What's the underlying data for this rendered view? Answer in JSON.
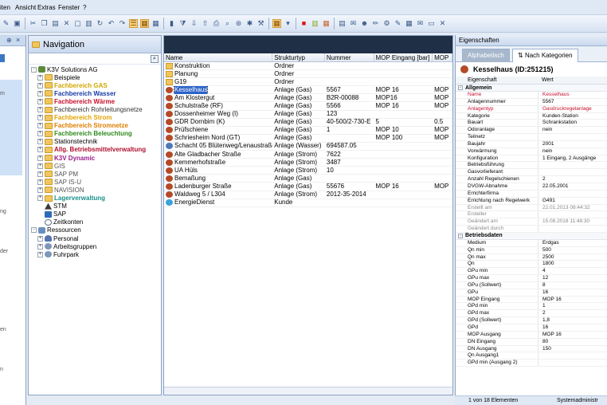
{
  "menu": {
    "items": [
      "iten",
      "Ansicht",
      "Extras",
      "Fenster",
      "?"
    ]
  },
  "left_strip": {
    "text": [
      "m",
      "ng",
      "der",
      "en",
      "n"
    ]
  },
  "nav": {
    "title": "Navigation",
    "tree": [
      {
        "label": "K3V Solutions AG",
        "icon": "root-icon",
        "expander": "-",
        "indent": 0,
        "style": ""
      },
      {
        "label": "Beispiele",
        "icon": "folder-icon",
        "expander": "+",
        "indent": 1,
        "style": ""
      },
      {
        "label": "Fachbereich GAS",
        "icon": "folder-icon",
        "expander": "+",
        "indent": 1,
        "style": "b c-gas"
      },
      {
        "label": "Fachbereich Wasser",
        "icon": "folder-icon",
        "expander": "+",
        "indent": 1,
        "style": "b c-wasser"
      },
      {
        "label": "Fachbereich Wärme",
        "icon": "folder-icon",
        "expander": "+",
        "indent": 1,
        "style": "b c-waerme"
      },
      {
        "label": "Fachbereich Rohrleitungsnetze",
        "icon": "folder-icon",
        "expander": "+",
        "indent": 1,
        "style": "c-rohr"
      },
      {
        "label": "Fachbereich Strom",
        "icon": "folder-icon",
        "expander": "+",
        "indent": 1,
        "style": "b c-strom"
      },
      {
        "label": "Fachbereich Stromnetze",
        "icon": "folder-icon",
        "expander": "+",
        "indent": 1,
        "style": "b c-stromnetze"
      },
      {
        "label": "Fachbereich Beleuchtung",
        "icon": "folder-icon",
        "expander": "+",
        "indent": 1,
        "style": "b c-bel"
      },
      {
        "label": "Stationstechnik",
        "icon": "folder-icon",
        "expander": "+",
        "indent": 1,
        "style": ""
      },
      {
        "label": "Allg. Betriebsmittelverwaltung",
        "icon": "folder-icon",
        "expander": "+",
        "indent": 1,
        "style": "b c-allg"
      },
      {
        "label": "K3V Dynamic",
        "icon": "folder-icon",
        "expander": "+",
        "indent": 1,
        "style": "b c-dyn"
      },
      {
        "label": "GIS",
        "icon": "folder-icon",
        "expander": "+",
        "indent": 1,
        "style": "c-gray"
      },
      {
        "label": "SAP PM",
        "icon": "folder-icon",
        "expander": "+",
        "indent": 1,
        "style": "c-gray"
      },
      {
        "label": "SAP IS-U",
        "icon": "folder-icon",
        "expander": "+",
        "indent": 1,
        "style": "c-gray"
      },
      {
        "label": "NAVISION",
        "icon": "folder-icon",
        "expander": "+",
        "indent": 1,
        "style": "c-gray"
      },
      {
        "label": "Lagerverwaltung",
        "icon": "folder-icon",
        "expander": "+",
        "indent": 1,
        "style": "b c-lager"
      },
      {
        "label": "STM",
        "icon": "stm-icon",
        "expander": "",
        "indent": 1,
        "style": ""
      },
      {
        "label": "SAP",
        "icon": "sap-icon",
        "expander": "",
        "indent": 1,
        "style": ""
      },
      {
        "label": "Zeitkonten",
        "icon": "clock-icon",
        "expander": "",
        "indent": 1,
        "style": ""
      },
      {
        "label": "Ressourcen",
        "icon": "db-icon",
        "expander": "-",
        "indent": 0,
        "style": ""
      },
      {
        "label": "Personal",
        "icon": "group-icon",
        "expander": "+",
        "indent": 1,
        "style": ""
      },
      {
        "label": "Arbeitsgruppen",
        "icon": "gear-icon",
        "expander": "+",
        "indent": 1,
        "style": ""
      },
      {
        "label": "Fuhrpark",
        "icon": "gear-icon",
        "expander": "+",
        "indent": 1,
        "style": ""
      }
    ]
  },
  "grid": {
    "columns": [
      "Name",
      "Strukturtyp",
      "Nummer",
      "MOP Eingang [bar]",
      "MOP"
    ],
    "rows": [
      {
        "icon": "folder-icon",
        "name": "Konstruktion",
        "typ": "Ordner",
        "nummer": "",
        "mop_in": "",
        "mop": "",
        "selected": false
      },
      {
        "icon": "folder-icon",
        "name": "Planung",
        "typ": "Ordner",
        "nummer": "",
        "mop_in": "",
        "mop": "",
        "selected": false
      },
      {
        "icon": "folder-icon",
        "name": "G19",
        "typ": "Ordner",
        "nummer": "",
        "mop_in": "",
        "mop": "",
        "selected": false
      },
      {
        "icon": "asset-icon",
        "name": "Kesselhaus",
        "typ": "Anlage (Gas)",
        "nummer": "5567",
        "mop_in": "MOP 16",
        "mop": "MOP",
        "selected": true
      },
      {
        "icon": "asset-icon",
        "name": "Am Klostergut",
        "typ": "Anlage (Gas)",
        "nummer": "B2R-00088",
        "mop_in": "MOP16",
        "mop": "MOP",
        "selected": false
      },
      {
        "icon": "asset-icon",
        "name": "Schulstraße (RF)",
        "typ": "Anlage (Gas)",
        "nummer": "5566",
        "mop_in": "MOP 16",
        "mop": "MOP",
        "selected": false
      },
      {
        "icon": "asset-icon",
        "name": "Dossenheimer Weg (I)",
        "typ": "Anlage (Gas)",
        "nummer": "123",
        "mop_in": "",
        "mop": "",
        "selected": false
      },
      {
        "icon": "asset-icon",
        "name": "GDR Dornbim (K)",
        "typ": "Anlage (Gas)",
        "nummer": "40-500/2-730-E",
        "mop_in": "5",
        "mop": "0.5",
        "selected": false
      },
      {
        "icon": "asset-icon",
        "name": "Prüfschiene",
        "typ": "Anlage (Gas)",
        "nummer": "1",
        "mop_in": "MOP 10",
        "mop": "MOP",
        "selected": false
      },
      {
        "icon": "asset-icon",
        "name": "Schriesheim Nord (GT)",
        "typ": "Anlage (Gas)",
        "nummer": "",
        "mop_in": "MOP 100",
        "mop": "MOP",
        "selected": false
      },
      {
        "icon": "asset2-icon",
        "name": "Schacht 05 Blütenweg/Lenaustraße",
        "typ": "Anlage (Wasser)",
        "nummer": "694587.05",
        "mop_in": "",
        "mop": "",
        "selected": false
      },
      {
        "icon": "asset-icon",
        "name": "Alte Gladbacher Straße",
        "typ": "Anlage (Strom)",
        "nummer": "7622",
        "mop_in": "",
        "mop": "",
        "selected": false
      },
      {
        "icon": "asset-icon",
        "name": "Kemmerhofstraße",
        "typ": "Anlage (Strom)",
        "nummer": "3487",
        "mop_in": "",
        "mop": "",
        "selected": false
      },
      {
        "icon": "asset-icon",
        "name": "UA Hüls",
        "typ": "Anlage (Strom)",
        "nummer": "10",
        "mop_in": "",
        "mop": "",
        "selected": false
      },
      {
        "icon": "asset-icon",
        "name": "Bemaßung",
        "typ": "Anlage (Gas)",
        "nummer": "",
        "mop_in": "",
        "mop": "",
        "selected": false
      },
      {
        "icon": "asset-icon",
        "name": "Ladenburger Straße",
        "typ": "Anlage (Gas)",
        "nummer": "55676",
        "mop_in": "MOP 16",
        "mop": "MOP",
        "selected": false
      },
      {
        "icon": "asset-icon",
        "name": "Waldweg 5 / L304",
        "typ": "Anlage (Strom)",
        "nummer": "2012-35-2014",
        "mop_in": "",
        "mop": "",
        "selected": false
      },
      {
        "icon": "service-icon",
        "name": "EnergieDienst",
        "typ": "Kunde",
        "nummer": "",
        "mop_in": "",
        "mop": "",
        "selected": false
      }
    ]
  },
  "props": {
    "title": "Eigenschaften",
    "tabs": [
      "Alphabetisch",
      "Nach Kategorien"
    ],
    "object_name": "Kesselhaus (ID:251215)",
    "col_property": "Eigenschaft",
    "col_value": "Wert",
    "categories": [
      {
        "name": "Allgemein",
        "rows": [
          {
            "label": "Name",
            "value": "Kesselhaus",
            "style": "red"
          },
          {
            "label": "Anlagennummer",
            "value": "5567",
            "style": ""
          },
          {
            "label": "Anlagentyp",
            "value": "Gasdruckregelanlage",
            "style": "red"
          },
          {
            "label": "Kategorie",
            "value": "Kunden-Station",
            "style": ""
          },
          {
            "label": "Bauart",
            "value": "Schrankstation",
            "style": ""
          },
          {
            "label": "Odoranlage",
            "value": "nein",
            "style": ""
          },
          {
            "label": "Teilnetz",
            "value": "",
            "style": ""
          },
          {
            "label": "Baujahr",
            "value": "2001",
            "style": ""
          },
          {
            "label": "Vorwärmung",
            "value": "nein",
            "style": ""
          },
          {
            "label": "Konfiguration",
            "value": "1 Eingang, 2 Ausgänge",
            "style": ""
          },
          {
            "label": "Betriebsführung",
            "value": "",
            "style": ""
          },
          {
            "label": "Gasvorlieferant",
            "value": "",
            "style": ""
          },
          {
            "label": "Anzahl Regelschienen",
            "value": "2",
            "style": ""
          },
          {
            "label": "DVGW-Abnahme",
            "value": "22.05.2001",
            "style": ""
          },
          {
            "label": "Errichterfirma",
            "value": "",
            "style": ""
          },
          {
            "label": "Errichtung nach Regelwerk",
            "value": "G491",
            "style": ""
          },
          {
            "label": "Erstellt am",
            "value": "22.01.2013 08:44:32",
            "style": "gray"
          },
          {
            "label": "Ersteller",
            "value": "",
            "style": "gray"
          },
          {
            "label": "Geändert am",
            "value": "15.08.2018 11:48:30",
            "style": "gray"
          },
          {
            "label": "Geändert durch",
            "value": "",
            "style": "gray"
          }
        ]
      },
      {
        "name": "Betriebsdaten",
        "rows": [
          {
            "label": "Medium",
            "value": "Erdgas",
            "style": ""
          },
          {
            "label": "Qn min",
            "value": "500",
            "style": ""
          },
          {
            "label": "Qn max",
            "value": "2500",
            "style": ""
          },
          {
            "label": "Qn",
            "value": "1800",
            "style": ""
          },
          {
            "label": "GPu min",
            "value": "4",
            "style": ""
          },
          {
            "label": "GPu max",
            "value": "12",
            "style": ""
          },
          {
            "label": "GPu (Sollwert)",
            "value": "8",
            "style": ""
          },
          {
            "label": "GPu",
            "value": "16",
            "style": ""
          },
          {
            "label": "MOP Eingang",
            "value": "MOP 16",
            "style": ""
          },
          {
            "label": "GPd min",
            "value": "1",
            "style": ""
          },
          {
            "label": "GPd max",
            "value": "2",
            "style": ""
          },
          {
            "label": "GPd (Sollwert)",
            "value": "1,8",
            "style": ""
          },
          {
            "label": "GPd",
            "value": "16",
            "style": ""
          },
          {
            "label": "MOP Ausgang",
            "value": "MOP 16",
            "style": ""
          },
          {
            "label": "DN Eingang",
            "value": "80",
            "style": ""
          },
          {
            "label": "DN Ausgang",
            "value": "150",
            "style": ""
          },
          {
            "label": "Qn Ausgang1",
            "value": "",
            "style": ""
          },
          {
            "label": "GPd min (Ausgang 2)",
            "value": "",
            "style": ""
          }
        ]
      }
    ]
  },
  "status": {
    "count": "1 von 18 Elementen",
    "user": "Systemadministr"
  },
  "colors": {
    "selection": "#2a62c9",
    "accent": "#3b78c2"
  }
}
